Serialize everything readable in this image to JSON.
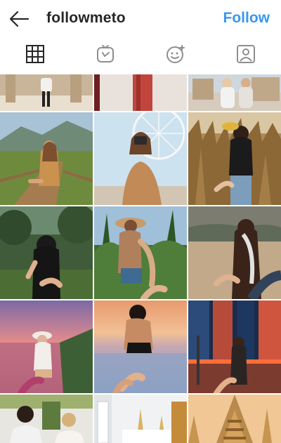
{
  "header": {
    "username": "followmeto",
    "follow_label": "Follow"
  },
  "tabs": [
    {
      "name": "grid",
      "active": true
    },
    {
      "name": "igtv",
      "active": false
    },
    {
      "name": "tagged-featured",
      "active": false
    },
    {
      "name": "tagged-photos",
      "active": false
    }
  ],
  "colors": {
    "accent": "#3897f0",
    "text": "#262626",
    "icon": "#8e8e8e"
  },
  "grid_posts": [
    {
      "id": "post-1",
      "subject": "temple courtyard walk"
    },
    {
      "id": "post-2",
      "subject": "red tower"
    },
    {
      "id": "post-3",
      "subject": "palace square"
    },
    {
      "id": "post-4",
      "subject": "mountain boardwalk"
    },
    {
      "id": "post-5",
      "subject": "ferris wheel camera"
    },
    {
      "id": "post-6",
      "subject": "wheat field"
    },
    {
      "id": "post-7",
      "subject": "forest path"
    },
    {
      "id": "post-8",
      "subject": "tropical palms hat"
    },
    {
      "id": "post-9",
      "subject": "desert walk"
    },
    {
      "id": "post-10",
      "subject": "sunset cliffs"
    },
    {
      "id": "post-11",
      "subject": "infinity pool sunset"
    },
    {
      "id": "post-12",
      "subject": "city night street"
    },
    {
      "id": "post-13",
      "subject": "street selfie"
    },
    {
      "id": "post-14",
      "subject": "white temple"
    },
    {
      "id": "post-15",
      "subject": "golden pagoda"
    }
  ]
}
